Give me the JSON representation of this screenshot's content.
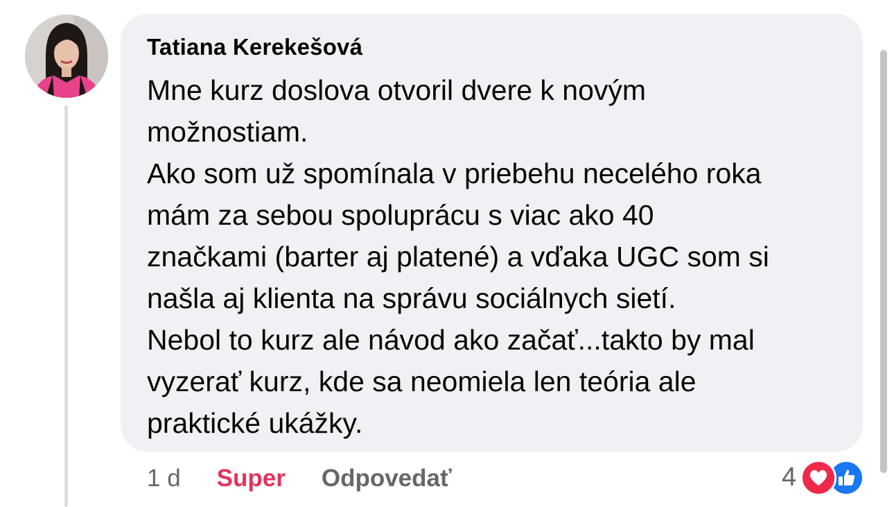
{
  "comment": {
    "author": "Tatiana Kerekešová",
    "lines": [
      "Mne kurz doslova otvoril dvere k novým",
      "možnostiam.",
      "Ako som už spomínala v priebehu necelého roka",
      "mám za sebou spoluprácu s viac ako 40",
      "značkami (barter aj platené) a vďaka UGC som si",
      "našla aj klienta na správu sociálnych sietí.",
      "Nebol to kurz ale návod ako začať...takto by mal",
      "vyzerať kurz, kde sa neomiela len teória ale",
      "praktické ukážky."
    ]
  },
  "actions": {
    "time": "1 d",
    "reaction_label": "Super",
    "reply_label": "Odpovedať"
  },
  "reactions": {
    "count": "4",
    "icons": [
      "heart-icon",
      "like-icon"
    ]
  },
  "colors": {
    "bubble": "#f0f1f4",
    "reaction_active": "#e0355b",
    "heart": "#f02849",
    "like": "#1877f2",
    "meta_text": "#65676b"
  }
}
